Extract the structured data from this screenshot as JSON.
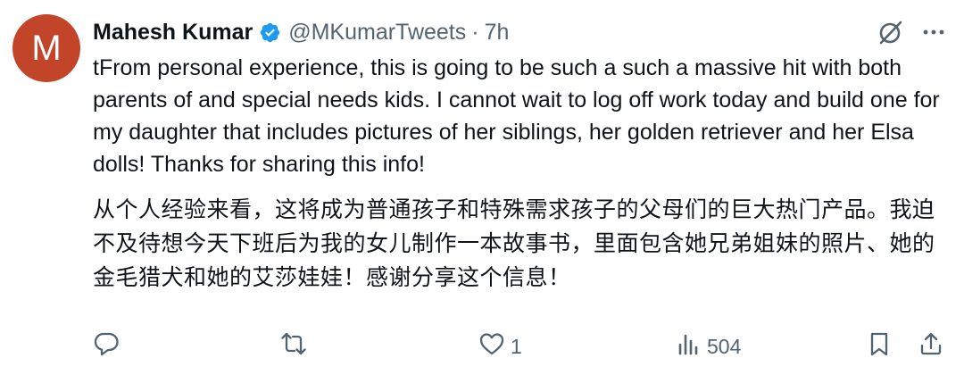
{
  "author": {
    "avatar_letter": "M",
    "name": "Mahesh Kumar",
    "handle": "@MKumarTweets",
    "separator": "·",
    "time": "7h"
  },
  "tweet": {
    "text_en": "tFrom personal experience, this is going to be such a such a massive hit with both parents of and special needs kids. I cannot wait to log off work today and build one for my daughter that includes pictures of her siblings, her golden retriever and her Elsa dolls!  Thanks for sharing this info!",
    "text_zh": "从个人经验来看，这将成为普通孩子和特殊需求孩子的父母们的巨大热门产品。我迫不及待想今天下班后为我的女儿制作一本故事书，里面包含她兄弟姐妹的照片、她的金毛猎犬和她的艾莎娃娃！感谢分享这个信息！"
  },
  "actions": {
    "likes": "1",
    "views": "504"
  },
  "icons": [
    "verified-badge-icon",
    "grok-icon",
    "more-icon",
    "reply-icon",
    "repost-icon",
    "like-icon",
    "views-icon",
    "bookmark-icon",
    "share-icon"
  ],
  "colors": {
    "avatar_bg": "#c2452a",
    "verified": "#1d9bf0",
    "secondary_text": "#536471",
    "primary_text": "#0f1419"
  }
}
